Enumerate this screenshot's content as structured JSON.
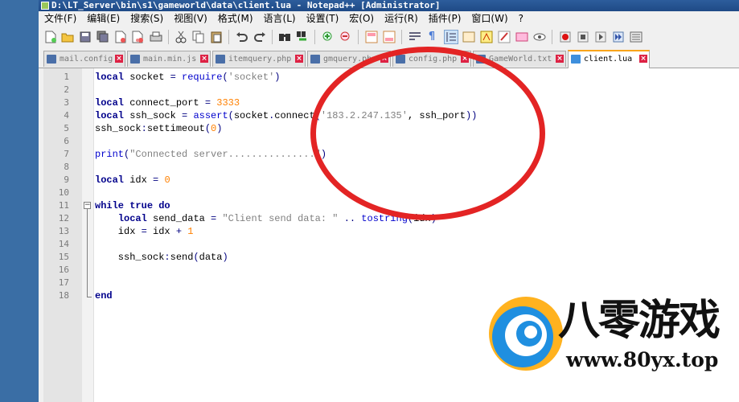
{
  "window": {
    "title": "D:\\LT_Server\\bin\\s1\\gameworld\\data\\client.lua - Notepad++ [Administrator]"
  },
  "menu": [
    "文件(F)",
    "编辑(E)",
    "搜索(S)",
    "视图(V)",
    "格式(M)",
    "语言(L)",
    "设置(T)",
    "宏(O)",
    "运行(R)",
    "插件(P)",
    "窗口(W)",
    "?"
  ],
  "toolbar": [
    "new-file-icon",
    "open-file-icon",
    "save-icon",
    "save-all-icon",
    "close-icon",
    "close-all-icon",
    "print-icon",
    "cut-icon",
    "copy-icon",
    "paste-icon",
    "undo-icon",
    "redo-icon",
    "find-icon",
    "replace-icon",
    "zoom-in-icon",
    "zoom-out-icon",
    "sync-v-icon",
    "sync-h-icon",
    "word-wrap-icon",
    "show-all-chars-icon",
    "indent-guide-icon",
    "doc-map-icon",
    "function-list-icon",
    "folder-workspace-icon",
    "doc-switcher-icon",
    "monitor-icon",
    "record-macro-icon",
    "stop-macro-icon",
    "play-macro-icon",
    "run-macro-multiple-icon",
    "save-macro-icon"
  ],
  "tabs": [
    {
      "label": "mail.config",
      "active": false
    },
    {
      "label": "main.min.js",
      "active": false
    },
    {
      "label": "itemquery.php",
      "active": false
    },
    {
      "label": "gmquery.php",
      "active": false
    },
    {
      "label": "config.php",
      "active": false
    },
    {
      "label": "GameWorld.txt",
      "active": false
    },
    {
      "label": "client.lua",
      "active": true
    }
  ],
  "code_lines": [
    "local socket = require('socket')",
    "",
    "local connect_port = 3333",
    "local ssh_sock = assert(socket.connect('183.2.247.135', ssh_port))",
    "ssh_sock:settimeout(0)",
    "",
    "print(\"Connected server...............\")",
    "",
    "local idx = 0",
    "",
    "while true do",
    "    local send_data = \"Client send data: \" .. tostring(idx)",
    "    idx = idx + 1",
    "",
    "    ssh_sock:send(data)",
    "",
    "",
    "end"
  ],
  "watermark": {
    "brand": "八零游戏",
    "url": "www.80yx.top"
  },
  "colors": {
    "annotation_circle": "#e32424",
    "active_tab_accent": "#f9a41a",
    "keyword": "#00008b",
    "number": "#ff8000",
    "string": "#808080"
  }
}
